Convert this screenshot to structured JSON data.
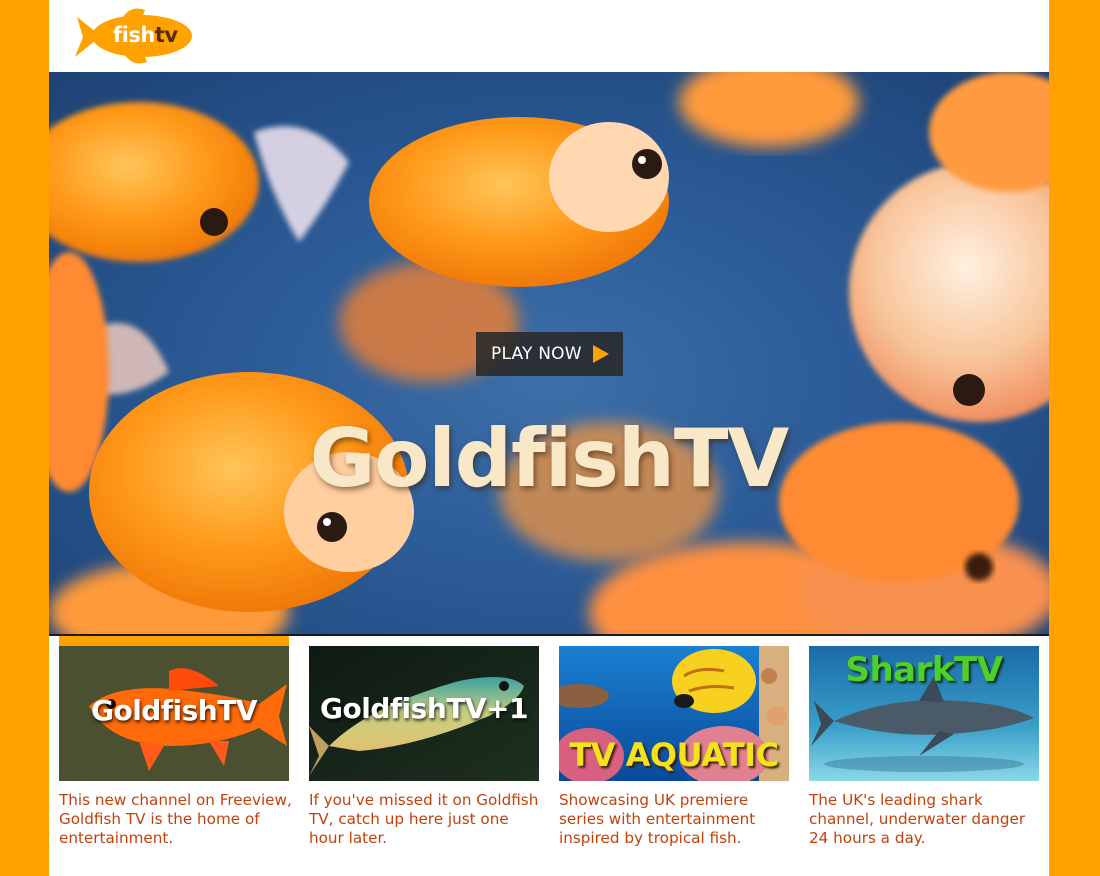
{
  "header": {
    "logo_fish": "fish",
    "logo_tv": "tv"
  },
  "hero": {
    "play_label": "PLAY NOW",
    "title": "GoldfishTV"
  },
  "channels": [
    {
      "name": "GoldfishTV",
      "description": "This new channel on Freeview, Goldfish TV is the home of entertainment.",
      "active": true
    },
    {
      "name": "GoldfishTV+1",
      "description": "If you've missed it on Goldfish TV, catch up here just one hour later."
    },
    {
      "name": "TV AQUATIC",
      "description": "Showcasing UK premiere series with entertainment inspired by tropical fish."
    },
    {
      "name": "SharkTV",
      "description": "The UK's leading shark channel, underwater danger 24 hours a day."
    }
  ],
  "colors": {
    "brand_orange": "#ffa200",
    "description_text": "#c2410c",
    "logo_tv": "#5a2b0a",
    "shark_title": "#4fcf2a",
    "aquatic_title": "#f4e21a"
  },
  "icons": {
    "logo": "goldfish-logo-icon",
    "play": "play-triangle-icon"
  }
}
